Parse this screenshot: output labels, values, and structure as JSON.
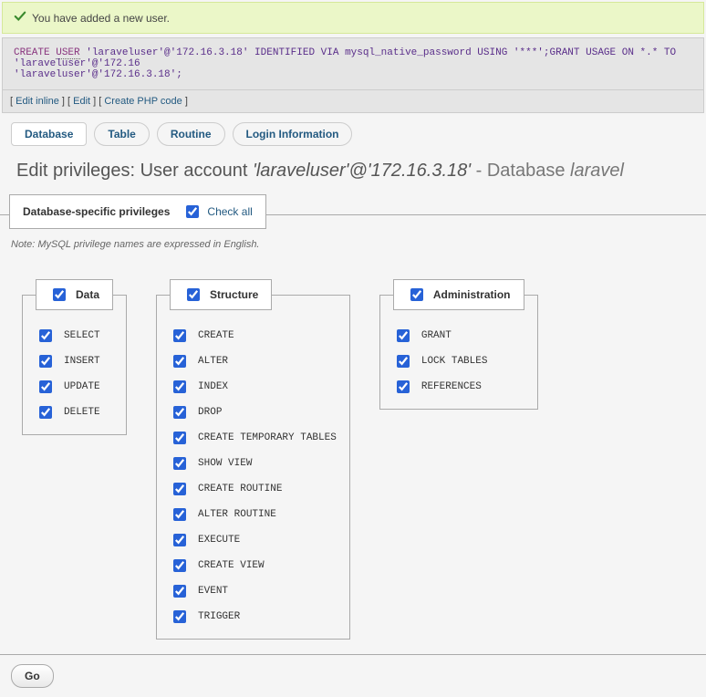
{
  "success_message": "You have added a new user.",
  "sql": {
    "line1_prefix": "CREATE ",
    "user_kw": "USER",
    "line1_rest": " 'laraveluser'@'172.16.3.18' IDENTIFIED VIA mysql_native_password USING '***';GRANT USAGE ON *.* TO 'laraveluser'@'172.16",
    "line2": "'laraveluser'@'172.16.3.18';"
  },
  "edit_links": {
    "edit_inline": "Edit inline",
    "edit": "Edit",
    "create_php": "Create PHP code"
  },
  "tabs": {
    "database": "Database",
    "table": "Table",
    "routine": "Routine",
    "login": "Login Information"
  },
  "title": {
    "prefix": "Edit privileges: User account ",
    "user": "'laraveluser'@'172.16.3.18'",
    "dash": " - ",
    "db_label": "Database ",
    "db_name": "laravel"
  },
  "panel_title": "Database-specific privileges",
  "check_all_label": "Check all",
  "note": "Note: MySQL privilege names are expressed in English.",
  "groups": {
    "data": {
      "title": "Data",
      "items": [
        "SELECT",
        "INSERT",
        "UPDATE",
        "DELETE"
      ]
    },
    "structure": {
      "title": "Structure",
      "items": [
        "CREATE",
        "ALTER",
        "INDEX",
        "DROP",
        "CREATE TEMPORARY TABLES",
        "SHOW VIEW",
        "CREATE ROUTINE",
        "ALTER ROUTINE",
        "EXECUTE",
        "CREATE VIEW",
        "EVENT",
        "TRIGGER"
      ]
    },
    "admin": {
      "title": "Administration",
      "items": [
        "GRANT",
        "LOCK TABLES",
        "REFERENCES"
      ]
    }
  },
  "go_label": "Go"
}
